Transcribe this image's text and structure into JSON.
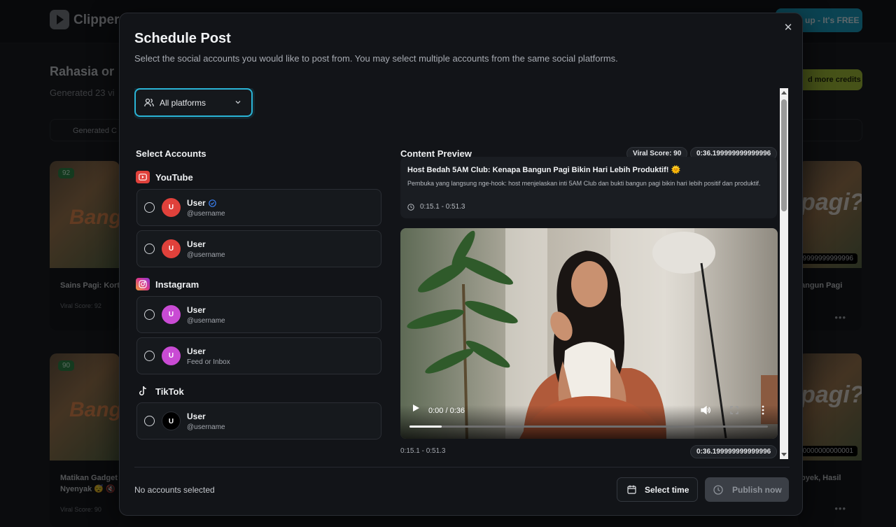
{
  "background": {
    "brand": "Clipper",
    "signup_label": "up - It's FREE",
    "page_title": "Rahasia or",
    "page_sub": "Generated 23 vi",
    "credits_label": "d more credits",
    "tab_label": "Generated C",
    "cards": [
      {
        "badge": "92",
        "title": "Sains Pagi: Kort",
        "score": "Viral Score: 92"
      },
      {
        "badge": "90",
        "title": "Matikan Gadget",
        "title2": "Nyenyak 😴 🔇",
        "score": "Viral Score: 90"
      },
      {
        "duration": "99999999999996",
        "title": "angun Pagi"
      },
      {
        "duration": "000000000000001",
        "title": "pyek, Hasil"
      }
    ],
    "thumb_words": {
      "bangun": "Bangu",
      "pagi": "pagi?"
    }
  },
  "modal": {
    "title": "Schedule Post",
    "description": "Select the social accounts you would like to post from. You may select multiple accounts from the same social platforms.",
    "platform_filter": "All platforms",
    "select_accounts_heading": "Select Accounts",
    "platforms": [
      {
        "name": "YouTube",
        "accounts": [
          {
            "initial": "U",
            "name": "User",
            "handle": "@username",
            "verified": true
          },
          {
            "initial": "U",
            "name": "User",
            "handle": "@username",
            "verified": false
          }
        ]
      },
      {
        "name": "Instagram",
        "accounts": [
          {
            "initial": "U",
            "name": "User",
            "handle": "@username"
          },
          {
            "initial": "U",
            "name": "User",
            "handle": "Feed or Inbox"
          }
        ]
      },
      {
        "name": "TikTok",
        "accounts": [
          {
            "initial": "U",
            "name": "User",
            "handle": "@username"
          }
        ]
      }
    ],
    "preview": {
      "heading": "Content Preview",
      "viral_score": "Viral Score: 90",
      "duration": "0:36.199999999999996",
      "clip_title": "Host Bedah 5AM Club: Kenapa Bangun Pagi Bikin Hari Lebih Produktif! 🌞",
      "clip_description": "Pembuka yang langsung nge-hook: host menjelaskan inti 5AM Club dan bukti bangun pagi bikin hari lebih positif dan produktif.",
      "clip_range": "0:15.1 - 0:51.3",
      "video_time": "0:00 / 0:36",
      "video_progress": 0.09,
      "range_under": "0:15.1 - 0:51.3",
      "duration_under": "0:36.199999999999996"
    },
    "footer": {
      "status": "No accounts selected",
      "select_time": "Select time",
      "publish": "Publish now"
    }
  },
  "colors": {
    "accent": "#2ab4d6",
    "youtube": "#e0413b",
    "instagram_avatar": "#c94bd4",
    "verified": "#3b82f6"
  }
}
